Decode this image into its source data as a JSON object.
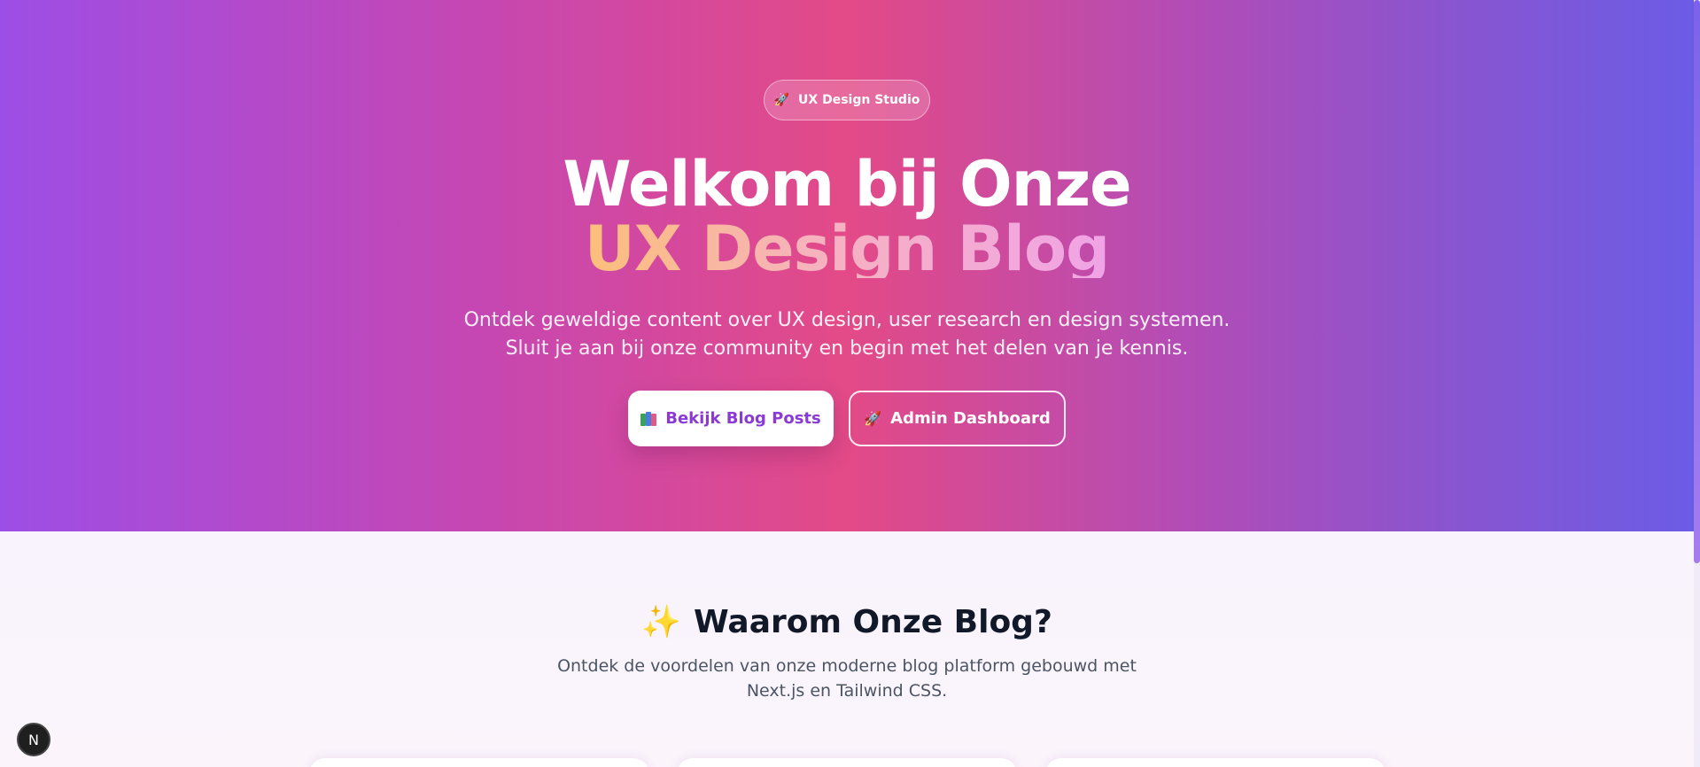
{
  "hero": {
    "badge": {
      "icon": "rocket-icon",
      "label": "UX Design Studio"
    },
    "title_line1": "Welkom bij Onze",
    "title_line2": "UX Design Blog",
    "subtitle": "Ontdek geweldige content over UX design, user research en design systemen. Sluit je aan bij onze community en begin met het delen van je kennis.",
    "primary_button": {
      "icon": "books-icon",
      "label": "Bekijk Blog Posts"
    },
    "secondary_button": {
      "icon": "rocket-icon",
      "label": "Admin Dashboard"
    }
  },
  "features": {
    "icon": "sparkles-icon",
    "title": "Waarom Onze Blog?",
    "subtitle": "Ontdek de voordelen van onze moderne blog platform gebouwd met Next.js en Tailwind CSS."
  },
  "dev_badge": {
    "label": "N"
  },
  "colors": {
    "hero_gradient": [
      "#9d4ee6",
      "#e34a87",
      "#6b5ce6"
    ],
    "primary_text": "#8b3ad6",
    "heading": "#111827"
  }
}
